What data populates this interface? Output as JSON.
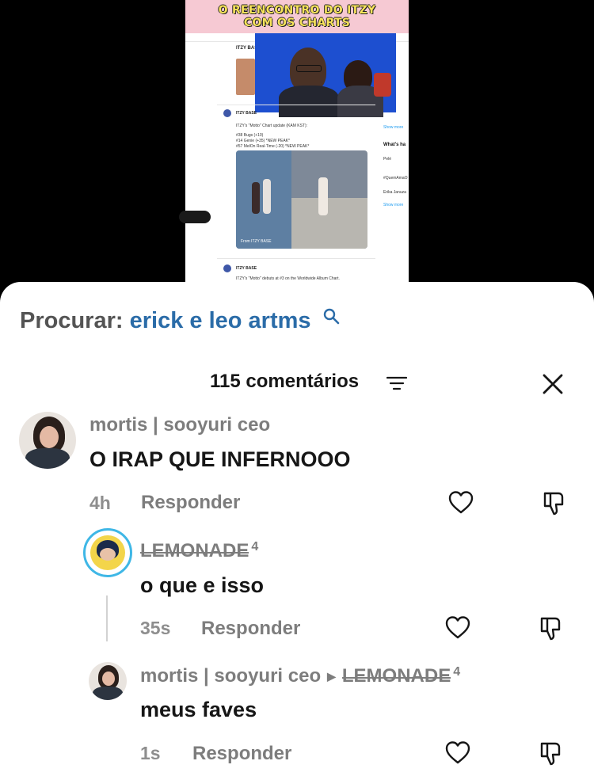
{
  "video": {
    "title_line1": "O REENCONTRO DO ITZY",
    "title_line2": "COM OS CHARTS",
    "account_name": "ITZY BASE",
    "tweet_line1": "ITZY's \"Motto\" Chart update (KAM KST):",
    "tweet_line2": "#38 Bugs (+10)",
    "tweet_line3": "#14 Genie (+35) *NEW PEAK*",
    "tweet_line4": "#57 MelOn Real-Time (-20) *NEW PEAK*",
    "media_caption": "From ITZY BASE",
    "tweet2_line": "ITZY's \"Motto\" debuts at #3 on the Worldwide Album Chart.",
    "right_header": "What's ha",
    "show_more": "Show more",
    "trend_1": "Pelé",
    "trend_2": "#QuemAmaO",
    "trend_3": "Erika Januza"
  },
  "search": {
    "label": "Procurar:",
    "term": "erick e leo artms"
  },
  "comments_header": {
    "count_label": "115 comentários"
  },
  "comments": [
    {
      "username": "mortis | sooyuri  ceo",
      "text": "O IRAP QUE INFERNOOO",
      "time": "4h",
      "reply_label": "Responder"
    },
    {
      "username": "LEMONADE",
      "username_sup": "4",
      "text": "o que e isso",
      "time": "35s",
      "reply_label": "Responder"
    },
    {
      "username": "mortis | sooyuri  ceo",
      "reply_to": "LEMONADE",
      "reply_to_sup": "4",
      "text": "meus faves",
      "time": "1s",
      "reply_label": "Responder"
    }
  ],
  "colors": {
    "accent_link": "#2b6ca8",
    "text_primary": "#161616",
    "text_secondary": "#7d7d7d",
    "avatar_ring": "#3fb7e6",
    "banner_pink": "#f6c9d3",
    "cam_blue": "#1d4fd0"
  },
  "icons": [
    "search-icon",
    "sort-icon",
    "close-icon",
    "heart-icon",
    "dislike-icon"
  ]
}
